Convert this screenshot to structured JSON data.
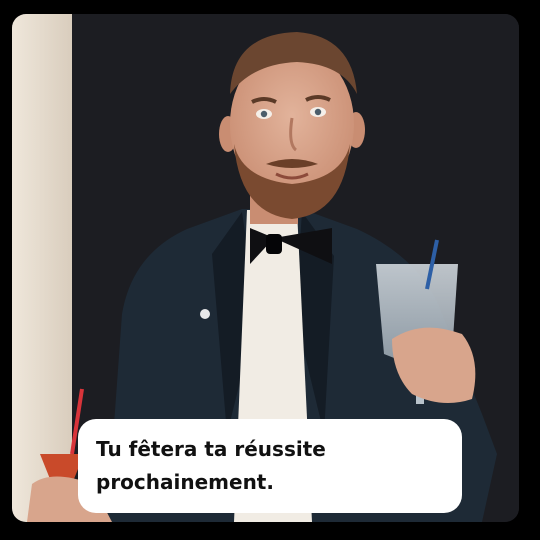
{
  "post": {
    "caption_lines": [
      "Tu fêtera ta réussite",
      "prochainement."
    ]
  },
  "photo": {
    "subject": "bearded-man-in-tuxedo-raising-glass",
    "colors": {
      "background": "#1c1d22",
      "wall_left": "#e9e0d2",
      "suit": "#1e2a36",
      "shirt": "#f1ece4",
      "skin": "#d8a58c",
      "hair": "#6b4630",
      "beard": "#7a4a30"
    }
  }
}
